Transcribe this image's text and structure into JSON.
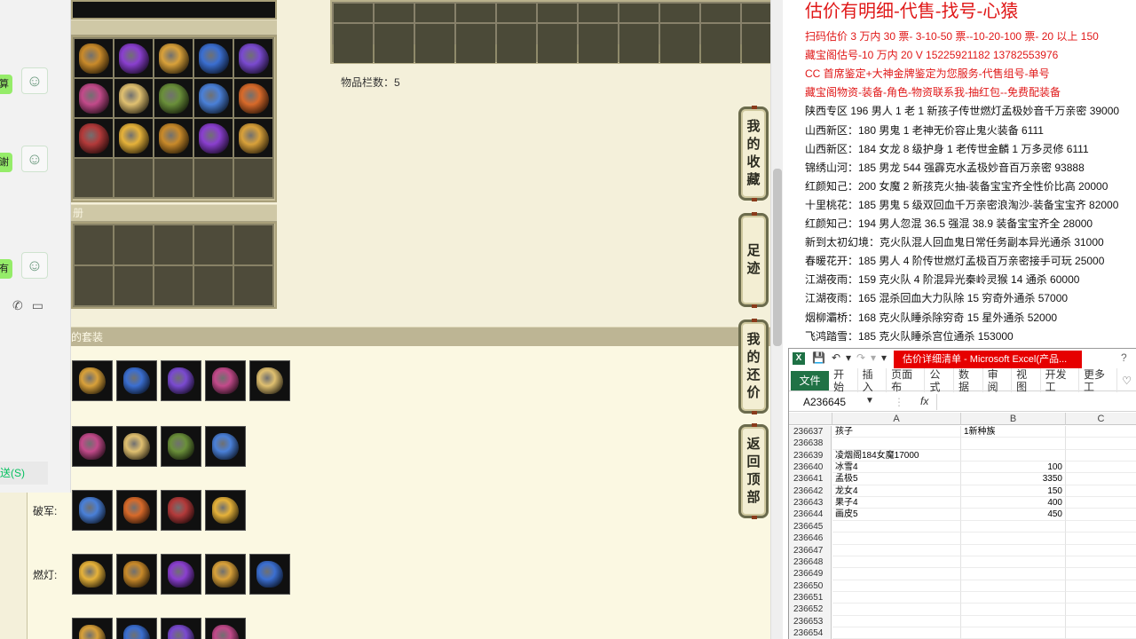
{
  "game": {
    "item_count_label": "物品栏数：5",
    "section_bar_1": "册",
    "set_header": "的套装",
    "side_buttons": [
      {
        "label": "我的收藏",
        "chars": [
          "我",
          "的",
          "收",
          "藏"
        ]
      },
      {
        "label": "足迹",
        "chars": [
          "足",
          "迹"
        ]
      },
      {
        "label": "我的还价",
        "chars": [
          "我",
          "的",
          "还",
          "价"
        ]
      },
      {
        "label": "返回顶部",
        "chars": [
          "返",
          "回",
          "顶",
          "部"
        ]
      }
    ],
    "set_rows": [
      {
        "label": "",
        "count": 5
      },
      {
        "label": "",
        "count": 4
      },
      {
        "label": "破军:",
        "count": 4
      },
      {
        "label": "燃灯:",
        "count": 5
      },
      {
        "label": "",
        "count": 4
      }
    ],
    "icon_colors": [
      "#c98a2a",
      "#8a3fcf",
      "#d9a13a",
      "#3b6fd1",
      "#7a4ad0",
      "#c24a8a",
      "#e0c070",
      "#6a8f3a",
      "#4a80d8",
      "#d86a2a",
      "#b33a3a",
      "#e6b23a"
    ]
  },
  "chat": {
    "bubble_fragments": [
      "算",
      "谢",
      "有"
    ],
    "send_button": "送(S)",
    "phone_icon": "phone-icon",
    "video_icon": "video-icon"
  },
  "price": {
    "title": "估价有明细-代售-找号-心猿",
    "lines": [
      {
        "text": "扫码估价 3 万内 30 票- 3-10-50 票--10-20-100 票- 20 以上 150",
        "color": "red"
      },
      {
        "text": "藏宝阁估号-10 万内 20 V 15225921182 13782553976",
        "color": "red"
      },
      {
        "text": "CC 首席鉴定+大神金牌鉴定为您服务-代售组号-单号",
        "color": "red"
      },
      {
        "text": "藏宝阁物资-装备-角色-物资联系我-抽红包--免费配装备",
        "color": "red"
      },
      {
        "text": "陕西专区 196 男人 1 老 1 新孩子传世燃灯孟极妙音千万亲密 39000",
        "color": "black"
      },
      {
        "text": "山西新区：180 男鬼 1 老神无价容止鬼火装备 6111",
        "color": "black"
      },
      {
        "text": "山西新区：184 女龙 8 级护身 1 老传世金麟 1 万多灵修 6111",
        "color": "black"
      },
      {
        "text": "锦绣山河：185 男龙 544 强霹克水孟极妙音百万亲密 93888",
        "color": "black"
      },
      {
        "text": "红颜知己：200 女魔 2 新孩克火抽-装备宝宝齐全性价比高 20000",
        "color": "black"
      },
      {
        "text": "十里桃花：185 男鬼 5 级双回血千万亲密浪淘沙-装备宝宝齐 82000",
        "color": "black"
      },
      {
        "text": "红颜知己：194 男人忽混 36.5 强混 38.9 装备宝宝齐全 28000",
        "color": "black"
      },
      {
        "text": "新到太初幻境：克火队混人回血鬼日常任务副本异光通杀 31000",
        "color": "black"
      },
      {
        "text": "春暖花开：185 男人 4 阶传世燃灯孟极百万亲密接手可玩 25000",
        "color": "black"
      },
      {
        "text": "江湖夜雨：159 克火队 4 阶混异光秦岭灵猴 14 通杀 60000",
        "color": "black"
      },
      {
        "text": "江湖夜雨：165 混杀回血大力队除 15 穷奇外通杀 57000",
        "color": "black"
      },
      {
        "text": "烟柳灞桥：168 克火队睡杀除穷奇 15 星外通杀 52000",
        "color": "black"
      },
      {
        "text": "飞鸿踏雪：185 克火队睡杀宫位通杀 153000",
        "color": "black"
      }
    ],
    "colors": {
      "red": "#e01818",
      "black": "#111111"
    }
  },
  "excel": {
    "title": "估价详细清单 - Microsoft Excel(产品...",
    "file_tab": "文件",
    "tabs": [
      "开始",
      "插入",
      "页面布",
      "公式",
      "数据",
      "审阅",
      "视图",
      "开发工",
      "更多工"
    ],
    "name_box": "A236645",
    "fx": "fx",
    "columns": [
      "A",
      "B",
      "C"
    ],
    "rows": [
      {
        "n": "236637",
        "a": "孩子",
        "b": "1新种族",
        "num": false
      },
      {
        "n": "236638",
        "a": "",
        "b": "",
        "num": false
      },
      {
        "n": "236639",
        "a": "凌烟阁184女魔17000",
        "b": "",
        "num": false
      },
      {
        "n": "236640",
        "a": "冰雪4",
        "b": "100",
        "num": true
      },
      {
        "n": "236641",
        "a": "孟极5",
        "b": "3350",
        "num": true
      },
      {
        "n": "236642",
        "a": "龙女4",
        "b": "150",
        "num": true
      },
      {
        "n": "236643",
        "a": "果子4",
        "b": "400",
        "num": true
      },
      {
        "n": "236644",
        "a": "画皮5",
        "b": "450",
        "num": true
      },
      {
        "n": "236645",
        "a": "",
        "b": "",
        "num": false
      },
      {
        "n": "236646",
        "a": "",
        "b": "",
        "num": false
      },
      {
        "n": "236647",
        "a": "",
        "b": "",
        "num": false
      },
      {
        "n": "236648",
        "a": "",
        "b": "",
        "num": false
      },
      {
        "n": "236649",
        "a": "",
        "b": "",
        "num": false
      },
      {
        "n": "236650",
        "a": "",
        "b": "",
        "num": false
      },
      {
        "n": "236651",
        "a": "",
        "b": "",
        "num": false
      },
      {
        "n": "236652",
        "a": "",
        "b": "",
        "num": false
      },
      {
        "n": "236653",
        "a": "",
        "b": "",
        "num": false
      },
      {
        "n": "236654",
        "a": "",
        "b": "",
        "num": false
      }
    ]
  }
}
